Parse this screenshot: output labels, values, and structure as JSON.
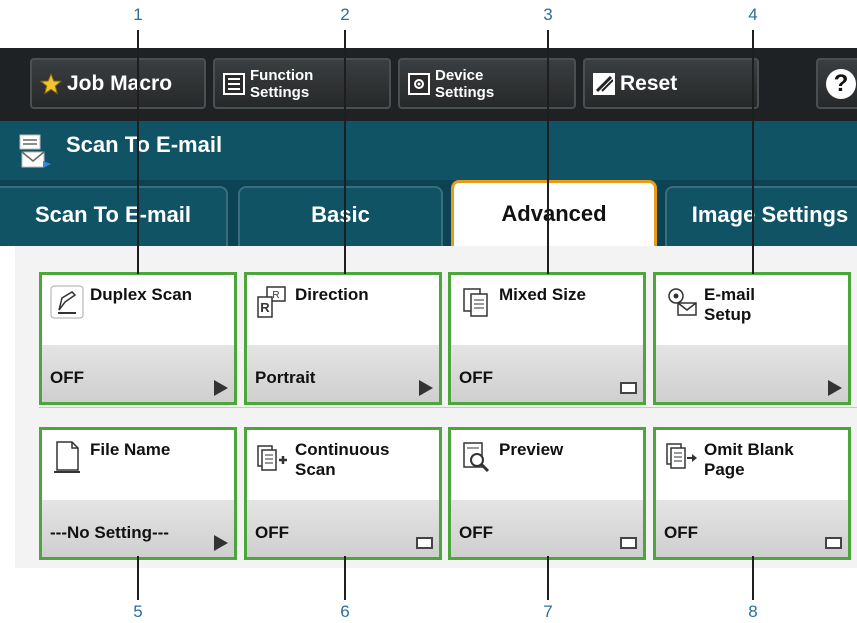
{
  "toolbar": {
    "job_macro": "Job Macro",
    "function_settings": "Function\nSettings",
    "device_settings": "Device\nSettings",
    "reset": "Reset",
    "help": "?"
  },
  "title": "Scan To E-mail",
  "tabs": [
    "Scan To E-mail",
    "Basic",
    "Advanced",
    "Image Settings"
  ],
  "active_tab": "Advanced",
  "cards": [
    {
      "name": "Duplex Scan",
      "value": "OFF",
      "icon": "duplex-scan-icon",
      "indicator": "arrow"
    },
    {
      "name": "Direction",
      "value": "Portrait",
      "icon": "direction-icon",
      "indicator": "arrow"
    },
    {
      "name": "Mixed Size",
      "value": "OFF",
      "icon": "mixed-size-icon",
      "indicator": "checkbox"
    },
    {
      "name": "E-mail\nSetup",
      "value": "",
      "icon": "email-setup-icon",
      "indicator": "arrow"
    },
    {
      "name": "File Name",
      "value": "---No Setting---",
      "icon": "file-name-icon",
      "indicator": "arrow"
    },
    {
      "name": "Continuous\nScan",
      "value": "OFF",
      "icon": "continuous-scan-icon",
      "indicator": "checkbox"
    },
    {
      "name": "Preview",
      "value": "OFF",
      "icon": "preview-icon",
      "indicator": "checkbox"
    },
    {
      "name": "Omit Blank\nPage",
      "value": "OFF",
      "icon": "omit-blank-page-icon",
      "indicator": "checkbox"
    }
  ],
  "callouts": [
    "1",
    "2",
    "3",
    "4",
    "5",
    "6",
    "7",
    "8"
  ],
  "colors": {
    "title_bar": "#0f5365",
    "toolbar": "#1f2224",
    "card_border": "#4ca63b",
    "active_tab_border": "#e89a1a",
    "callout_text": "#2c6f9c"
  }
}
